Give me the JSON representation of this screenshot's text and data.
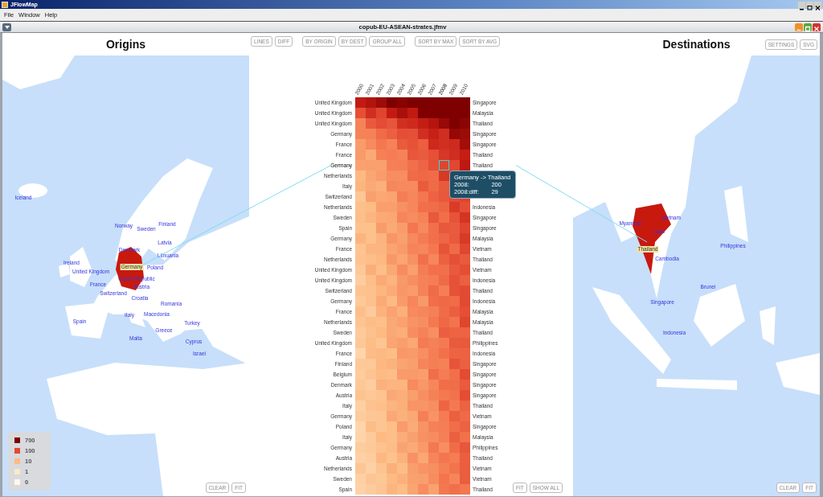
{
  "app_window": {
    "title": "JFlowMap"
  },
  "menu": [
    "File",
    "Window",
    "Help"
  ],
  "document_window": {
    "title": "copub-EU-ASEAN-strates.jfmv"
  },
  "origins_panel": {
    "title": "Origins",
    "map_labels": [
      {
        "label": "Iceland",
        "selected": false
      },
      {
        "label": "Norway",
        "selected": false
      },
      {
        "label": "Sweden",
        "selected": false
      },
      {
        "label": "Finland",
        "selected": false
      },
      {
        "label": "Latvia",
        "selected": false
      },
      {
        "label": "Denmark",
        "selected": false
      },
      {
        "label": "Lithuania",
        "selected": false
      },
      {
        "label": "Ireland",
        "selected": false
      },
      {
        "label": "Germany",
        "selected": true
      },
      {
        "label": "Poland",
        "selected": false
      },
      {
        "label": "United Kingdom",
        "selected": false
      },
      {
        "label": "Czech Republic",
        "selected": false
      },
      {
        "label": "France",
        "selected": false
      },
      {
        "label": "Austria",
        "selected": false
      },
      {
        "label": "Switzerland",
        "selected": false
      },
      {
        "label": "Croatia",
        "selected": false
      },
      {
        "label": "Romania",
        "selected": false
      },
      {
        "label": "Italy",
        "selected": false
      },
      {
        "label": "Macedonia",
        "selected": false
      },
      {
        "label": "Spain",
        "selected": false
      },
      {
        "label": "Turkey",
        "selected": false
      },
      {
        "label": "Greece",
        "selected": false
      },
      {
        "label": "Malta",
        "selected": false
      },
      {
        "label": "Cyprus",
        "selected": false
      },
      {
        "label": "Israel",
        "selected": false
      }
    ],
    "legend": [
      {
        "label": "700",
        "color": "#7f0000"
      },
      {
        "label": "100",
        "color": "#e34a33"
      },
      {
        "label": "10",
        "color": "#fdbb84"
      },
      {
        "label": "1",
        "color": "#fee8c8"
      },
      {
        "label": "0",
        "color": "#fff7ec"
      }
    ],
    "buttons": [
      "CLEAR",
      "FIT"
    ]
  },
  "toolbar": {
    "groups": [
      [
        "LINES",
        "DIFF"
      ],
      [
        "BY ORIGIN",
        "BY DEST",
        "GROUP ALL"
      ],
      [
        "SORT BY MAX",
        "SORT BY AVG"
      ]
    ]
  },
  "heatmap": {
    "years": [
      {
        "label": "2000",
        "selected": false
      },
      {
        "label": "2001",
        "selected": false
      },
      {
        "label": "2002",
        "selected": false
      },
      {
        "label": "2003",
        "selected": false
      },
      {
        "label": "2004",
        "selected": false
      },
      {
        "label": "2005",
        "selected": false
      },
      {
        "label": "2006",
        "selected": false
      },
      {
        "label": "2007",
        "selected": false
      },
      {
        "label": "2008",
        "selected": true
      },
      {
        "label": "2009",
        "selected": false
      },
      {
        "label": "2010",
        "selected": false
      }
    ],
    "rows": [
      {
        "origin": "United Kingdom",
        "destination": "Singapore",
        "selected": false
      },
      {
        "origin": "United Kingdom",
        "destination": "Malaysia",
        "selected": false
      },
      {
        "origin": "United Kingdom",
        "destination": "Thailand",
        "selected": false
      },
      {
        "origin": "Germany",
        "destination": "Singapore",
        "selected": false
      },
      {
        "origin": "France",
        "destination": "Singapore",
        "selected": false
      },
      {
        "origin": "France",
        "destination": "Thailand",
        "selected": false
      },
      {
        "origin": "Germany",
        "destination": "Thailand",
        "selected": true
      },
      {
        "origin": "Netherlands",
        "selected": false
      },
      {
        "origin": "Italy",
        "selected": false
      },
      {
        "origin": "Switzerland",
        "selected": false
      },
      {
        "origin": "Netherlands",
        "destination": "Indonesia",
        "selected": false
      },
      {
        "origin": "Sweden",
        "destination": "Singapore",
        "selected": false
      },
      {
        "origin": "Spain",
        "destination": "Singapore",
        "selected": false
      },
      {
        "origin": "Germany",
        "destination": "Malaysia",
        "selected": false
      },
      {
        "origin": "France",
        "destination": "Vietnam",
        "selected": false
      },
      {
        "origin": "Netherlands",
        "destination": "Thailand",
        "selected": false
      },
      {
        "origin": "United Kingdom",
        "destination": "Vietnam",
        "selected": false
      },
      {
        "origin": "United Kingdom",
        "destination": "Indonesia",
        "selected": false
      },
      {
        "origin": "Switzerland",
        "destination": "Thailand",
        "selected": false
      },
      {
        "origin": "Germany",
        "destination": "Indonesia",
        "selected": false
      },
      {
        "origin": "France",
        "destination": "Malaysia",
        "selected": false
      },
      {
        "origin": "Netherlands",
        "destination": "Malaysia",
        "selected": false
      },
      {
        "origin": "Sweden",
        "destination": "Thailand",
        "selected": false
      },
      {
        "origin": "United Kingdom",
        "destination": "Philippines",
        "selected": false
      },
      {
        "origin": "France",
        "destination": "Indonesia",
        "selected": false
      },
      {
        "origin": "Finland",
        "destination": "Singapore",
        "selected": false
      },
      {
        "origin": "Belgium",
        "destination": "Singapore",
        "selected": false
      },
      {
        "origin": "Denmark",
        "destination": "Singapore",
        "selected": false
      },
      {
        "origin": "Austria",
        "destination": "Singapore",
        "selected": false
      },
      {
        "origin": "Italy",
        "destination": "Thailand",
        "selected": false
      },
      {
        "origin": "Germany",
        "destination": "Vietnam",
        "selected": false
      },
      {
        "origin": "Poland",
        "destination": "Singapore",
        "selected": false
      },
      {
        "origin": "Italy",
        "destination": "Malaysia",
        "selected": false
      },
      {
        "origin": "Germany",
        "destination": "Philippines",
        "selected": false
      },
      {
        "origin": "Austria",
        "destination": "Thailand",
        "selected": false
      },
      {
        "origin": "Netherlands",
        "destination": "Vietnam",
        "selected": false
      },
      {
        "origin": "Sweden",
        "destination": "Vietnam",
        "selected": false
      },
      {
        "origin": "Spain",
        "destination": "Thailand",
        "selected": false
      }
    ],
    "tooltip": {
      "title": "Germany -> Thailand",
      "lines": [
        {
          "label": "2008:",
          "value": "200"
        },
        {
          "label": "2008:diff:",
          "value": "29"
        }
      ]
    },
    "buttons": [
      "FIT",
      "SHOW ALL"
    ]
  },
  "destinations_panel": {
    "title": "Destinations",
    "top_buttons": [
      "SETTINGS",
      "SVG"
    ],
    "map_labels": [
      {
        "label": "Myanmar",
        "selected": false
      },
      {
        "label": "Vietnam",
        "selected": false
      },
      {
        "label": "Laos",
        "selected": false
      },
      {
        "label": "Thailand",
        "selected": true
      },
      {
        "label": "Cambodia",
        "selected": false
      },
      {
        "label": "Philippines",
        "selected": false
      },
      {
        "label": "Brunei",
        "selected": false
      },
      {
        "label": "Singapore",
        "selected": false
      },
      {
        "label": "Indonesia",
        "selected": false
      }
    ],
    "buttons": [
      "CLEAR",
      "FIT"
    ]
  }
}
